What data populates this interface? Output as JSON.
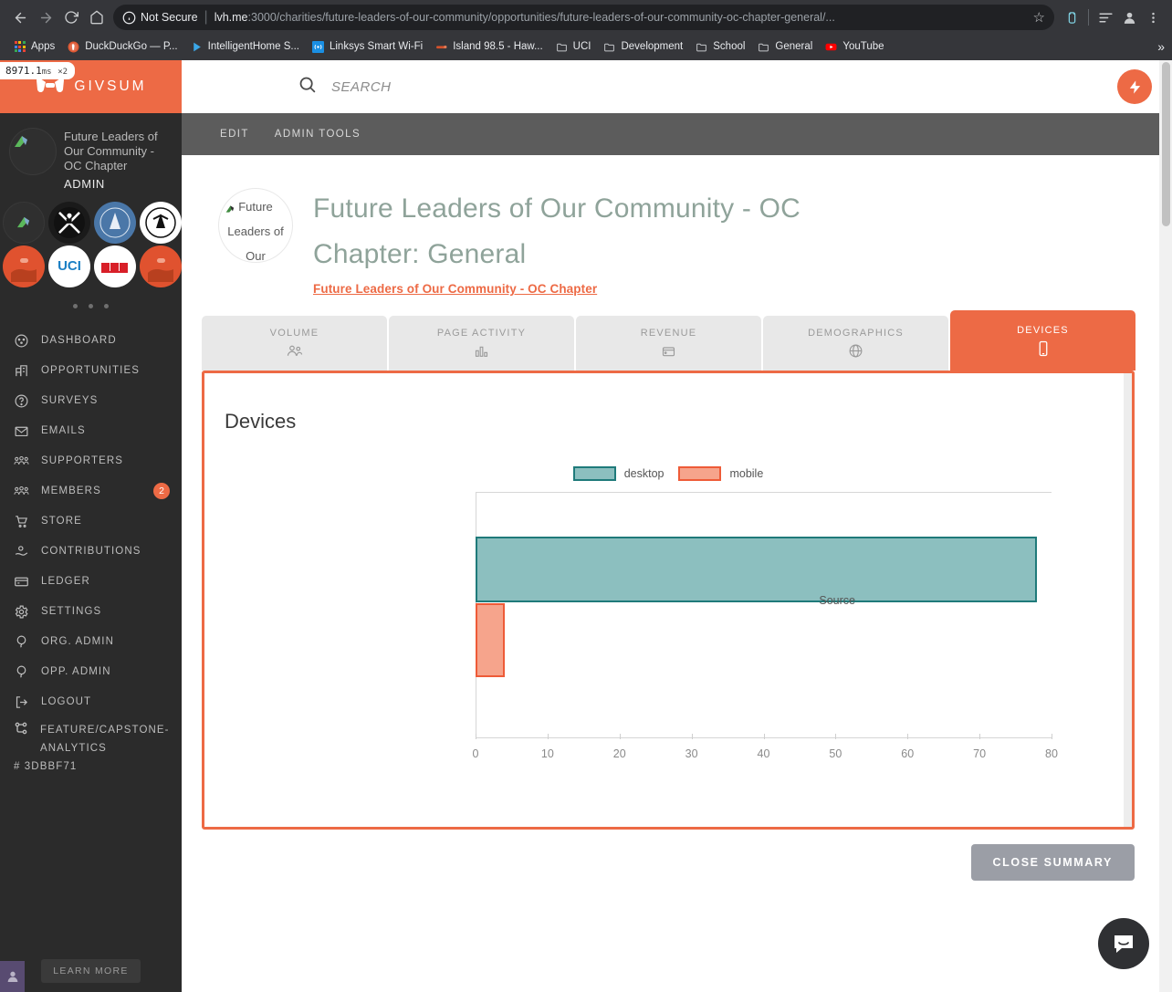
{
  "browser": {
    "security_label": "Not Secure",
    "url_host": "lvh.me",
    "url_path": ":3000/charities/future-leaders-of-our-community/opportunities/future-leaders-of-our-community-oc-chapter-general/...",
    "back_icon": "back-arrow-icon",
    "forward_icon": "forward-arrow-icon",
    "reload_icon": "reload-icon",
    "home_icon": "home-icon",
    "star_icon": "bookmark-star-icon",
    "extension_icon": "extension-icon",
    "reading_list_icon": "reading-list-icon",
    "profile_icon": "profile-icon",
    "menu_icon": "kebab-menu-icon",
    "bookmarks": [
      {
        "label": "Apps",
        "icon": "apps-grid-icon"
      },
      {
        "label": "DuckDuckGo — P...",
        "icon": "duckduckgo-icon"
      },
      {
        "label": "IntelligentHome S...",
        "icon": "play-triangle-icon"
      },
      {
        "label": "Linksys Smart Wi-Fi",
        "icon": "wifi-signal-icon"
      },
      {
        "label": "Island 98.5 - Haw...",
        "icon": "radio-icon"
      },
      {
        "label": "UCI",
        "icon": "folder-icon"
      },
      {
        "label": "Development",
        "icon": "folder-icon"
      },
      {
        "label": "School",
        "icon": "folder-icon"
      },
      {
        "label": "General",
        "icon": "folder-icon"
      },
      {
        "label": "YouTube",
        "icon": "youtube-icon"
      }
    ],
    "overflow_label": "»"
  },
  "perf_overlay": {
    "time": "8971.1",
    "unit": "ms",
    "count": "×2"
  },
  "sidebar": {
    "brand": "GIVSUM",
    "org": {
      "name": "Future Leaders of Our Community - OC Chapter",
      "role": "ADMIN"
    },
    "org_chips": [
      {
        "name": "chip-current-org",
        "style": "empty",
        "text": ""
      },
      {
        "name": "chip-black-cross",
        "style": "black",
        "text": ""
      },
      {
        "name": "chip-blue-seal",
        "style": "blue",
        "text": ""
      },
      {
        "name": "chip-white-seal",
        "style": "white-black",
        "text": ""
      },
      {
        "name": "chip-orange-hand",
        "style": "orange",
        "text": ""
      },
      {
        "name": "chip-uci",
        "style": "uci",
        "text": "UCI"
      },
      {
        "name": "chip-red-banner",
        "style": "white-red",
        "text": ""
      },
      {
        "name": "chip-orange-hand-2",
        "style": "orange",
        "text": ""
      }
    ],
    "items": [
      {
        "label": "DASHBOARD",
        "icon": "dashboard-gauge-icon",
        "badge": ""
      },
      {
        "label": "OPPORTUNITIES",
        "icon": "building-chart-icon",
        "badge": ""
      },
      {
        "label": "SURVEYS",
        "icon": "question-circle-icon",
        "badge": ""
      },
      {
        "label": "EMAILS",
        "icon": "envelope-icon",
        "badge": ""
      },
      {
        "label": "SUPPORTERS",
        "icon": "people-group-icon",
        "badge": ""
      },
      {
        "label": "MEMBERS",
        "icon": "people-group-icon",
        "badge": "2"
      },
      {
        "label": "STORE",
        "icon": "shopping-cart-icon",
        "badge": ""
      },
      {
        "label": "CONTRIBUTIONS",
        "icon": "hand-donate-icon",
        "badge": ""
      },
      {
        "label": "LEDGER",
        "icon": "credit-card-icon",
        "badge": ""
      },
      {
        "label": "SETTINGS",
        "icon": "gear-icon",
        "badge": ""
      },
      {
        "label": "ORG. ADMIN",
        "icon": "balloon-icon",
        "badge": ""
      },
      {
        "label": "OPP. ADMIN",
        "icon": "balloon-icon",
        "badge": ""
      },
      {
        "label": "LOGOUT",
        "icon": "logout-arrow-icon",
        "badge": ""
      }
    ],
    "branch": {
      "icon": "git-branch-icon",
      "name": "FEATURE/CAPSTONE-ANALYTICS",
      "sha": "# 3DBBF71"
    },
    "learn_more": "LEARN MORE"
  },
  "topbar": {
    "search_placeholder": "SEARCH",
    "search_value": "",
    "search_icon": "search-icon",
    "bolt_icon": "lightning-bolt-icon"
  },
  "adminbar": {
    "edit": "EDIT",
    "admin_tools": "ADMIN TOOLS"
  },
  "header": {
    "avatar_text": "Future Leaders of Our",
    "title": "Future Leaders of Our Community - OC Chapter: General",
    "sub_link": "Future Leaders of Our Community - OC Chapter"
  },
  "tabs": [
    {
      "label": "VOLUME",
      "icon": "people-icon",
      "active": false
    },
    {
      "label": "PAGE ACTIVITY",
      "icon": "bar-chart-icon",
      "active": false
    },
    {
      "label": "REVENUE",
      "icon": "wallet-icon",
      "active": false
    },
    {
      "label": "DEMOGRAPHICS",
      "icon": "globe-icon",
      "active": false
    },
    {
      "label": "DEVICES",
      "icon": "mobile-device-icon",
      "active": true
    }
  ],
  "panel": {
    "title": "Devices",
    "accent_color": "#ED6A45"
  },
  "footer": {
    "close_summary": "CLOSE SUMMARY"
  },
  "intercom": {
    "icon": "chat-bubble-icon"
  },
  "chart_data": {
    "type": "bar",
    "orientation": "horizontal",
    "title": "Devices",
    "categories": [
      "Source"
    ],
    "series": [
      {
        "name": "desktop",
        "values": [
          78
        ],
        "color": "#8CBFBF",
        "border": "#1F7A7A"
      },
      {
        "name": "mobile",
        "values": [
          4
        ],
        "color": "#F6A48C",
        "border": "#EE5B38"
      }
    ],
    "xlabel": "",
    "ylabel": "Source",
    "xlim": [
      0,
      80
    ],
    "xticks": [
      0,
      10,
      20,
      30,
      40,
      50,
      60,
      70,
      80
    ],
    "grid": false,
    "legend_position": "top"
  }
}
